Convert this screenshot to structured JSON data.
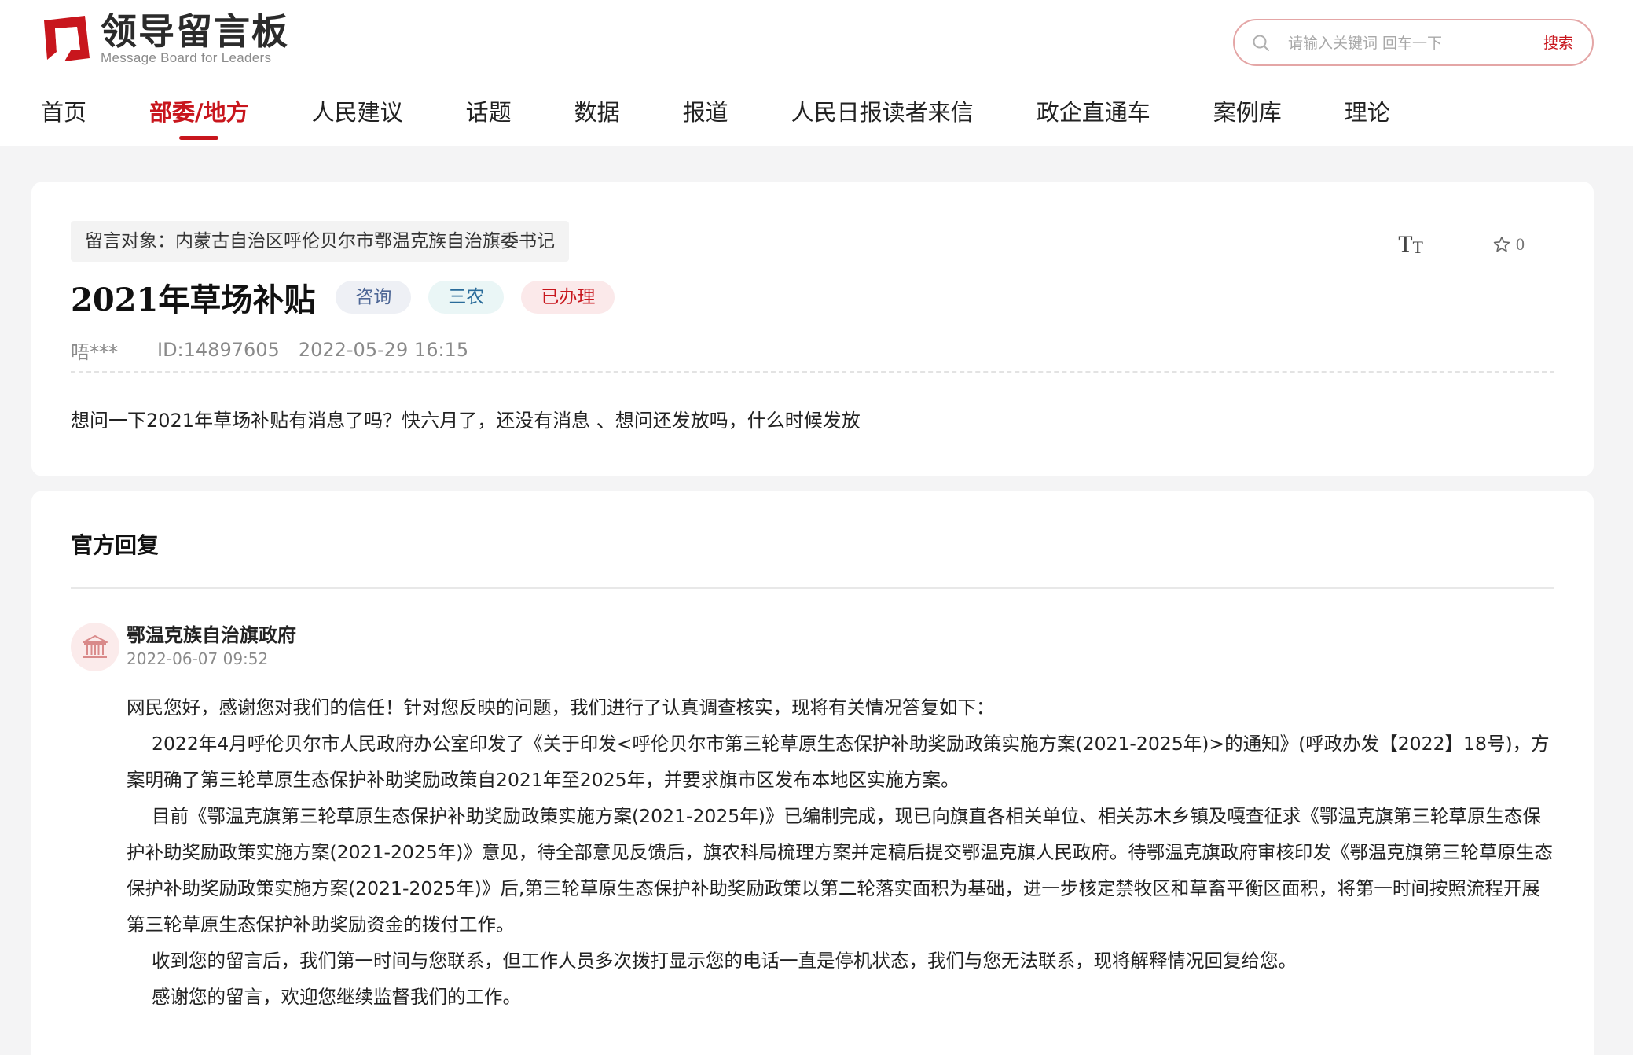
{
  "logo": {
    "title": "领导留言板",
    "subtitle": "Message Board for Leaders",
    "brand_color": "#c8161d"
  },
  "search": {
    "placeholder": "请输入关键词 回车一下",
    "button_label": "搜索",
    "icon": "search-icon"
  },
  "nav": {
    "items": [
      {
        "label": "首页",
        "active": false
      },
      {
        "label": "部委/地方",
        "active": true
      },
      {
        "label": "人民建议",
        "active": false
      },
      {
        "label": "话题",
        "active": false
      },
      {
        "label": "数据",
        "active": false
      },
      {
        "label": "报道",
        "active": false
      },
      {
        "label": "人民日报读者来信",
        "active": false
      },
      {
        "label": "政企直通车",
        "active": false
      },
      {
        "label": "案例库",
        "active": false
      },
      {
        "label": "理论",
        "active": false
      }
    ]
  },
  "message": {
    "target": "留言对象：内蒙古自治区呼伦贝尔市鄂温克族自治旗委书记",
    "title": "2021年草场补贴",
    "badges": {
      "type": "咨询",
      "category": "三农",
      "status": "已办理"
    },
    "author": "唔***",
    "id": "ID:14897605",
    "datetime": "2022-05-29 16:15",
    "content": "想问一下2021年草场补贴有消息了吗？快六月了，还没有消息 、想问还发放吗，什么时候发放",
    "tools": {
      "font_size_big": "T",
      "font_size_small": "T",
      "favorite_count": "0",
      "favorite_icon": "star-outline-icon"
    }
  },
  "reply": {
    "heading": "官方回复",
    "responder": "鄂温克族自治旗政府",
    "datetime": "2022-06-07 09:52",
    "avatar_icon": "government-building-icon",
    "paragraphs": [
      "网民您好，感谢您对我们的信任！针对您反映的问题，我们进行了认真调查核实，现将有关情况答复如下：",
      "2022年4月呼伦贝尔市人民政府办公室印发了《关于印发<呼伦贝尔市第三轮草原生态保护补助奖励政策实施方案(2021-2025年)>的通知》(呼政办发【2022】18号)，方案明确了第三轮草原生态保护补助奖励政策自2021年至2025年，并要求旗市区发布本地区实施方案。",
      "目前《鄂温克旗第三轮草原生态保护补助奖励政策实施方案(2021-2025年)》已编制完成，现已向旗直各相关单位、相关苏木乡镇及嘎查征求《鄂温克旗第三轮草原生态保护补助奖励政策实施方案(2021-2025年)》意见，待全部意见反馈后，旗农科局梳理方案并定稿后提交鄂温克旗人民政府。待鄂温克旗政府审核印发《鄂温克旗第三轮草原生态保护补助奖励政策实施方案(2021-2025年)》后,第三轮草原生态保护补助奖励政策以第二轮落实面积为基础，进一步核定禁牧区和草畜平衡区面积，将第一时间按照流程开展第三轮草原生态保护补助奖励资金的拨付工作。",
      "收到您的留言后，我们第一时间与您联系，但工作人员多次拨打显示您的电话一直是停机状态，我们与您无法联系，现将解释情况回复给您。",
      "感谢您的留言，欢迎您继续监督我们的工作。"
    ]
  }
}
